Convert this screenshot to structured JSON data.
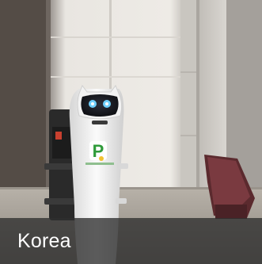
{
  "caption": {
    "label": "Korea",
    "bar_color": "#2e2e2e",
    "text_color": "#ffffff"
  },
  "photo": {
    "subject": "robot-photo",
    "logo_letter": "P"
  }
}
